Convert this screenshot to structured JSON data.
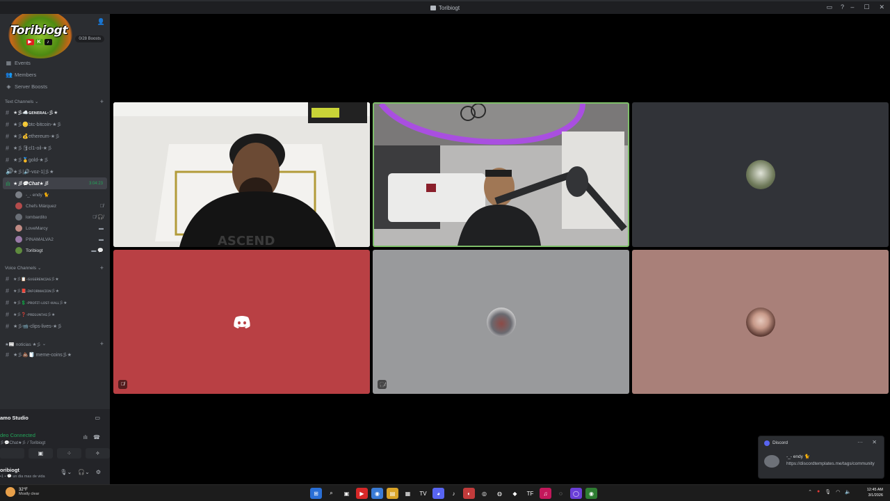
{
  "window": {
    "title": "Toribiogt"
  },
  "server": {
    "logo_text": "Toribiogt",
    "boosts_label": "0/28 Boosts",
    "nav": [
      {
        "label": "Events",
        "icon": "calendar-icon"
      },
      {
        "label": "Members",
        "icon": "members-icon"
      },
      {
        "label": "Server Boosts",
        "icon": "boost-icon"
      }
    ]
  },
  "text_category": {
    "label": "Text Channels"
  },
  "text_channels": [
    {
      "label": "★彡☁️ɢᴇɴᴇʀᴀʟ-彡★"
    },
    {
      "label": "★彡🪙btc-bitcoin-★彡"
    },
    {
      "label": "★彡💰ethereum-★彡"
    },
    {
      "label": "★彡🛢cl1-oil-★彡"
    },
    {
      "label": "★彡🥇gold-★彡"
    },
    {
      "label": "★彡|🔊-voz-1|彡★"
    }
  ],
  "active_voice": {
    "label": "★彡💬Chat★彡",
    "time": "3:04:23"
  },
  "voice_users": [
    {
      "name": "-_- endy 🐈",
      "color": "#7b7f86"
    },
    {
      "name": "Chefs Márquez",
      "color": "#b34b4b"
    },
    {
      "name": "lombardito",
      "color": "#6a6f77"
    },
    {
      "name": "LoveMarcy",
      "color": "#c08b84"
    },
    {
      "name": "PINAMALVA2",
      "color": "#9a7aa8"
    },
    {
      "name": "Toribiogt",
      "color": "#5f8b3e"
    }
  ],
  "voice_category": {
    "label": "Voice Channels"
  },
  "voice_channels": [
    {
      "label": "★彡📋-ꜱᴜɢᴇʀᴇɴᴄɪᴀꜱ彡★"
    },
    {
      "label": "★彡📕-ɪɴꜰᴏʀᴍᴀᴄɪᴏɴ彡★"
    },
    {
      "label": "★彡💲-ᴘʀᴏꜰɪᴛ-ʟᴏꜱᴛ-ᴡᴀʟʟ彡★"
    },
    {
      "label": "★彡❓-ᴘʀᴇɢᴜɴᴛᴀꜱ彡★"
    },
    {
      "label": "★彡📹-clips-lives-★彡"
    }
  ],
  "news_category": {
    "label": "★📰 noticias ★彡"
  },
  "news_channels": [
    {
      "label": "★彡💩🧻 meme-coins彡★"
    }
  ],
  "panel": {
    "studio": "amo Studio",
    "voice_status": "deo Connected",
    "voice_sub": "彡💬Chat★彡 / Toribiogt",
    "username": "oribiogt",
    "user_status": "•1 • 💬 un dia mas de vida"
  },
  "tiles": [
    {
      "type": "video-room-1",
      "bg": "#d9d9d6"
    },
    {
      "type": "video-room-2",
      "bg": "#8b8d93"
    },
    {
      "type": "avatar",
      "bg": "#313338",
      "avatar_color": "#7d8c6a"
    },
    {
      "type": "discord",
      "bg": "#b94044"
    },
    {
      "type": "avatar",
      "bg": "#999a9c",
      "avatar_color": "#8d4a46"
    },
    {
      "type": "avatar",
      "bg": "#a98079",
      "avatar_color": "#5d3b34"
    }
  ],
  "notification": {
    "app": "Discord",
    "sender": "-_- endy 🐈",
    "message": "https://discordtemplates.me/tags/community"
  },
  "taskbar": {
    "temp": "32°F",
    "weather": "Mostly clear",
    "time": "12:45 AM",
    "date": "3/1/2026"
  }
}
